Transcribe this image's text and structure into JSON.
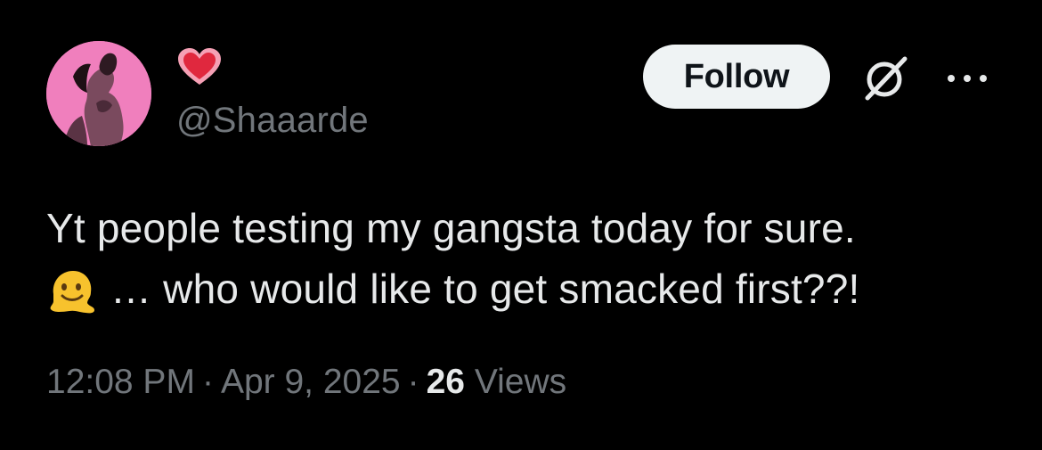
{
  "author": {
    "display_name_icon": "red-heart-emoji-icon",
    "handle": "@Shaaarde",
    "avatar_bg": "#f07fbd"
  },
  "actions": {
    "follow_label": "Follow",
    "grok_icon": "grok-slash-icon",
    "more_icon": "more-ellipsis-icon"
  },
  "tweet": {
    "line1": "Yt people testing my gangsta today for sure.",
    "line2_emoji": "melting-face-emoji",
    "line2": "… who would like to get smacked first??!"
  },
  "meta": {
    "time": "12:08 PM",
    "separator": "·",
    "date": "Apr 9, 2025",
    "views_count": "26",
    "views_label": "Views"
  },
  "colors": {
    "background": "#000000",
    "text_primary": "#e7e9ea",
    "text_secondary": "#71767b",
    "follow_bg": "#eff3f4",
    "follow_text": "#0f1419"
  }
}
